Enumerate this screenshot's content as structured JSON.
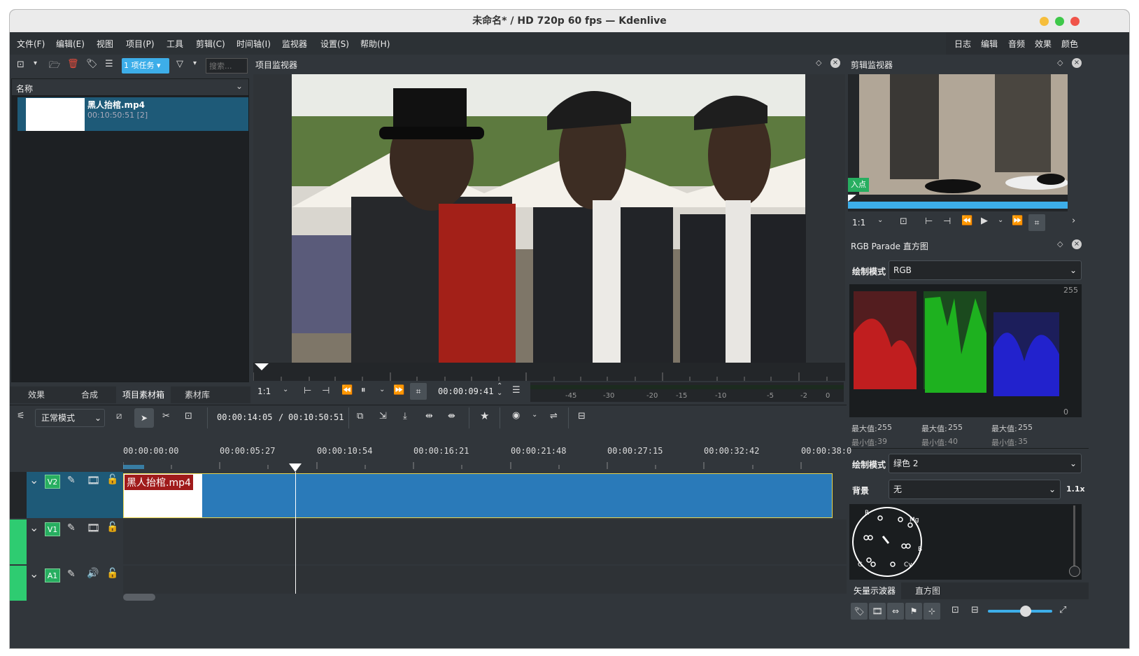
{
  "window": {
    "title": "未命名* / HD 720p 60 fps — Kdenlive"
  },
  "menu": [
    "文件(F)",
    "编辑(E)",
    "视图",
    "项目(P)",
    "工具",
    "剪辑(C)",
    "时间轴(I)",
    "监视器",
    "设置(S)",
    "帮助(H)"
  ],
  "layouts": [
    "日志",
    "编辑",
    "音频",
    "效果",
    "颜色"
  ],
  "bin": {
    "tasks_label": "1 项任务",
    "search_placeholder": "搜索...",
    "column_name": "名称",
    "clip_name": "黑人抬棺.mp4",
    "clip_duration": "00:10:50:51 [2]"
  },
  "bin_tabs": [
    "效果",
    "合成",
    "项目素材箱",
    "素材库"
  ],
  "project_monitor": {
    "title": "项目监视器",
    "zoom": "1:1",
    "timecode": "00:00:09:41",
    "audio_scale": [
      "-45",
      "-30",
      "-20",
      "-15",
      "-10",
      "-5",
      "-2",
      "0"
    ]
  },
  "clip_monitor": {
    "title": "剪辑监视器",
    "in_point": "入点",
    "zoom": "1:1"
  },
  "rgb_parade": {
    "title": "RGB Parade 直方图",
    "mode_label": "绘制模式",
    "mode_value": "RGB",
    "scale_max": "255",
    "scale_min": "0",
    "max_label": "最大值:",
    "min_label": "最小值:",
    "channels": [
      {
        "name": "red",
        "max": "255",
        "min": "39"
      },
      {
        "name": "green",
        "max": "255",
        "min": "40"
      },
      {
        "name": "blue",
        "max": "255",
        "min": "35"
      }
    ]
  },
  "vectorscope": {
    "mode_label": "绘制模式",
    "mode_value": "绿色 2",
    "bg_label": "背景",
    "bg_value": "无",
    "gain": "1.1x",
    "tabs": [
      "矢量示波器",
      "直方图"
    ],
    "markers": [
      "R",
      "Mg",
      "B",
      "Cy",
      "G"
    ]
  },
  "timeline": {
    "edit_mode": "正常模式",
    "position": "00:00:14:05",
    "duration": "00:10:50:51",
    "separator": "/",
    "ruler": [
      "00:00:00:00",
      "00:00:05:27",
      "00:00:10:54",
      "00:00:16:21",
      "00:00:21:48",
      "00:00:27:15",
      "00:00:32:42",
      "00:00:38:0"
    ],
    "tracks": [
      {
        "name": "V2",
        "type": "video"
      },
      {
        "name": "V1",
        "type": "video"
      },
      {
        "name": "A1",
        "type": "audio"
      }
    ],
    "clip_label": "黑人抬棺.mp4"
  },
  "colors": {
    "accent": "#3daee9",
    "track_green": "#27ae60",
    "clip_blue": "#2a7ab9",
    "selection": "#1e5a78"
  }
}
